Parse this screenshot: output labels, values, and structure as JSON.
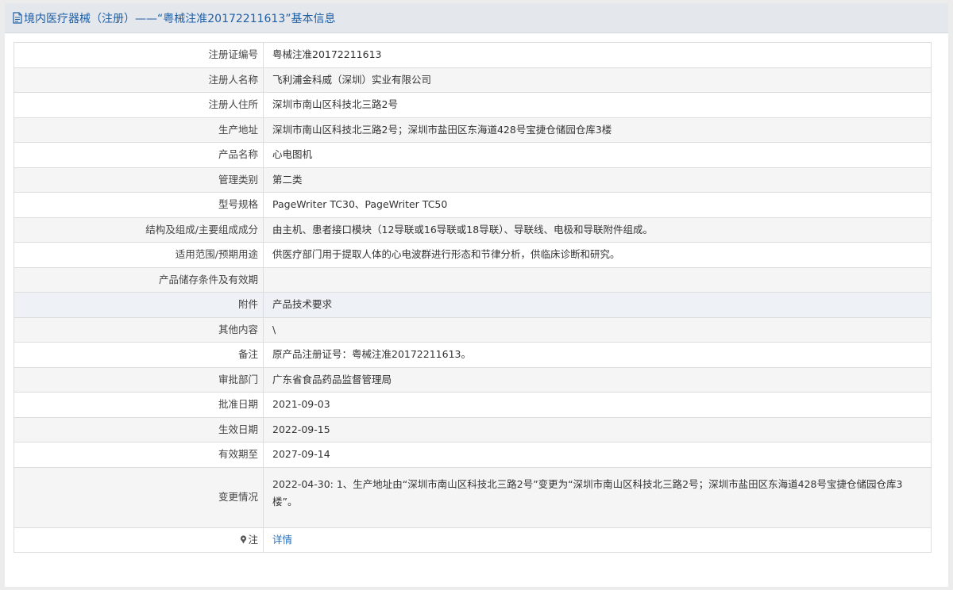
{
  "header": {
    "title": "境内医疗器械（注册）——“粤械注准20172211613”基本信息",
    "icon": "document-icon"
  },
  "rows": [
    {
      "label": "注册证编号",
      "value": "粤械注准20172211613"
    },
    {
      "label": "注册人名称",
      "value": "飞利浦金科威（深圳）实业有限公司"
    },
    {
      "label": "注册人住所",
      "value": "深圳市南山区科技北三路2号"
    },
    {
      "label": "生产地址",
      "value": "深圳市南山区科技北三路2号；深圳市盐田区东海道428号宝捷仓储园仓库3楼"
    },
    {
      "label": "产品名称",
      "value": "心电图机"
    },
    {
      "label": "管理类别",
      "value": "第二类"
    },
    {
      "label": "型号规格",
      "value": "PageWriter TC30、PageWriter TC50"
    },
    {
      "label": "结构及组成/主要组成成分",
      "value": "由主机、患者接口模块（12导联或16导联或18导联）、导联线、电极和导联附件组成。"
    },
    {
      "label": "适用范围/预期用途",
      "value": "供医疗部门用于提取人体的心电波群进行形态和节律分析，供临床诊断和研究。"
    },
    {
      "label": "产品储存条件及有效期",
      "value": ""
    },
    {
      "label": "附件",
      "value": "产品技术要求"
    },
    {
      "label": "其他内容",
      "value": "\\"
    },
    {
      "label": "备注",
      "value": "原产品注册证号：粤械注准20172211613。"
    },
    {
      "label": "审批部门",
      "value": "广东省食品药品监督管理局"
    },
    {
      "label": "批准日期",
      "value": "2021-09-03"
    },
    {
      "label": "生效日期",
      "value": "2022-09-15"
    },
    {
      "label": "有效期至",
      "value": "2027-09-14"
    },
    {
      "label": "变更情况",
      "value": "2022-04-30: 1、生产地址由“深圳市南山区科技北三路2号”变更为“深圳市南山区科技北三路2号；深圳市盐田区东海道428号宝捷仓储园仓库3楼”。"
    }
  ],
  "note": {
    "icon": "pin-icon",
    "label": "注",
    "link_text": "详情"
  }
}
